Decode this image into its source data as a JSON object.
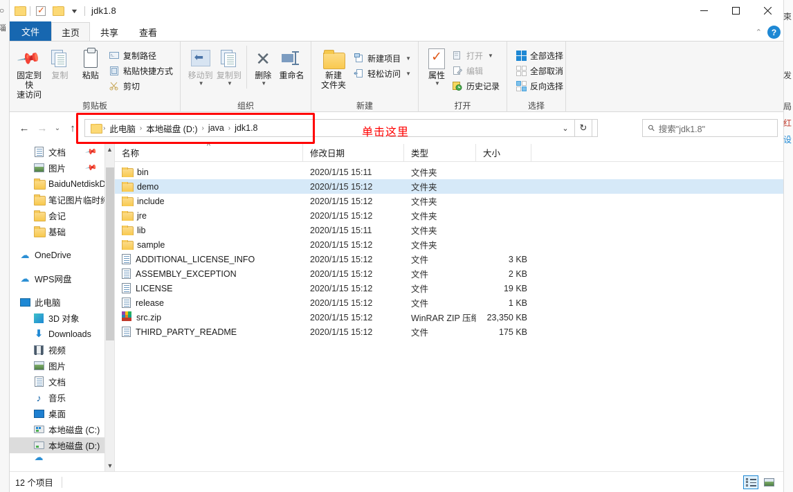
{
  "window": {
    "title": "jdk1.8",
    "quick_access": [
      "folder-icon",
      "properties-check-icon",
      "new-folder-icon",
      "customize-caret-icon"
    ],
    "controls": {
      "minimize": "—",
      "maximize": "❐",
      "close": "✕"
    }
  },
  "tabs": {
    "file": "文件",
    "items": [
      {
        "label": "主页",
        "active": true
      },
      {
        "label": "共享",
        "active": false
      },
      {
        "label": "查看",
        "active": false
      }
    ],
    "collapse_icon": "chevron-up-icon",
    "help_icon": "help-icon",
    "help_label": "?"
  },
  "ribbon": {
    "groups": [
      {
        "title": "剪贴板",
        "big": [
          {
            "label1": "固定到快",
            "label2": "速访问",
            "icon": "pin-icon",
            "dim": false
          },
          {
            "label1": "复制",
            "label2": "",
            "icon": "copy-icon",
            "dim": true
          },
          {
            "label1": "粘贴",
            "label2": "",
            "icon": "paste-icon",
            "dim": false
          }
        ],
        "small": [
          {
            "label": "复制路径",
            "icon": "copy-path-icon",
            "dim": false
          },
          {
            "label": "粘贴快捷方式",
            "icon": "paste-shortcut-icon",
            "dim": false
          },
          {
            "label": "剪切",
            "icon": "scissors-icon",
            "dim": false
          }
        ]
      },
      {
        "title": "组织",
        "big": [
          {
            "label1": "移动到",
            "label2": "",
            "icon": "move-to-icon",
            "dim": true
          },
          {
            "label1": "复制到",
            "label2": "",
            "icon": "copy-to-icon",
            "dim": true
          },
          {
            "label1": "删除",
            "label2": "",
            "icon": "delete-icon",
            "dim": false
          },
          {
            "label1": "重命名",
            "label2": "",
            "icon": "rename-icon",
            "dim": false
          }
        ]
      },
      {
        "title": "新建",
        "big": [
          {
            "label1": "新建",
            "label2": "文件夹",
            "icon": "new-folder-icon",
            "dim": false
          }
        ],
        "small": [
          {
            "label": "新建项目",
            "icon": "new-item-icon",
            "dim": false,
            "caret": true
          },
          {
            "label": "轻松访问",
            "icon": "easy-access-icon",
            "dim": false,
            "caret": true
          }
        ]
      },
      {
        "title": "打开",
        "big": [
          {
            "label1": "属性",
            "label2": "",
            "icon": "properties-icon",
            "dim": false
          }
        ],
        "small": [
          {
            "label": "打开",
            "icon": "open-icon",
            "dim": true,
            "caret": true
          },
          {
            "label": "编辑",
            "icon": "edit-icon",
            "dim": true
          },
          {
            "label": "历史记录",
            "icon": "history-icon",
            "dim": false
          }
        ]
      },
      {
        "title": "选择",
        "small": [
          {
            "label": "全部选择",
            "icon": "select-all-icon",
            "dim": false
          },
          {
            "label": "全部取消",
            "icon": "select-none-icon",
            "dim": false
          },
          {
            "label": "反向选择",
            "icon": "invert-selection-icon",
            "dim": false
          }
        ]
      }
    ]
  },
  "addressbar": {
    "back_icon": "arrow-left-icon",
    "forward_icon": "arrow-right-icon",
    "recent_icon": "chevron-down-icon",
    "up_icon": "arrow-up-icon",
    "folder_icon": "folder-icon",
    "breadcrumbs": [
      "此电脑",
      "本地磁盘 (D:)",
      "java",
      "jdk1.8"
    ],
    "separator": "›",
    "dropdown_icon": "chevron-down-icon",
    "refresh_icon": "refresh-icon",
    "refresh_glyph": "↻"
  },
  "search": {
    "icon": "search-icon",
    "placeholder": "搜索\"jdk1.8\"",
    "value": ""
  },
  "annotation": {
    "label": "单击这里",
    "color": "#ff0000"
  },
  "navpane": {
    "items": [
      {
        "label": "文档",
        "icon": "documents-icon",
        "indent": 2,
        "pinned": true,
        "selected": false
      },
      {
        "label": "图片",
        "icon": "pictures-icon",
        "indent": 2,
        "pinned": true,
        "selected": false
      },
      {
        "label": "BaiduNetdiskD",
        "icon": "folder-icon",
        "indent": 2,
        "pinned": false,
        "selected": false
      },
      {
        "label": "笔记图片临时纯",
        "icon": "folder-icon",
        "indent": 2,
        "pinned": false,
        "selected": false
      },
      {
        "label": "会记",
        "icon": "folder-icon",
        "indent": 2,
        "pinned": false,
        "selected": false
      },
      {
        "label": "基础",
        "icon": "folder-icon",
        "indent": 2,
        "pinned": false,
        "selected": false
      },
      {
        "spacer": true
      },
      {
        "label": "OneDrive",
        "icon": "onedrive-icon",
        "indent": 1,
        "pinned": false,
        "selected": false
      },
      {
        "spacer": true
      },
      {
        "label": "WPS网盘",
        "icon": "wps-cloud-icon",
        "indent": 1,
        "pinned": false,
        "selected": false
      },
      {
        "spacer": true
      },
      {
        "label": "此电脑",
        "icon": "this-pc-icon",
        "indent": 1,
        "pinned": false,
        "selected": false
      },
      {
        "label": "3D 对象",
        "icon": "3d-objects-icon",
        "indent": 2,
        "pinned": false,
        "selected": false
      },
      {
        "label": "Downloads",
        "icon": "downloads-icon",
        "indent": 2,
        "pinned": false,
        "selected": false
      },
      {
        "label": "视频",
        "icon": "videos-icon",
        "indent": 2,
        "pinned": false,
        "selected": false
      },
      {
        "label": "图片",
        "icon": "pictures-icon",
        "indent": 2,
        "pinned": false,
        "selected": false
      },
      {
        "label": "文档",
        "icon": "documents-icon",
        "indent": 2,
        "pinned": false,
        "selected": false
      },
      {
        "label": "音乐",
        "icon": "music-icon",
        "indent": 2,
        "pinned": false,
        "selected": false
      },
      {
        "label": "桌面",
        "icon": "desktop-icon",
        "indent": 2,
        "pinned": false,
        "selected": false
      },
      {
        "label": "本地磁盘 (C:)",
        "icon": "system-drive-icon",
        "indent": 2,
        "pinned": false,
        "selected": false
      },
      {
        "label": "本地磁盘 (D:)",
        "icon": "drive-icon",
        "indent": 2,
        "pinned": false,
        "selected": true
      }
    ],
    "scrollbar": {
      "up": "▲",
      "down": "▼"
    }
  },
  "filelist": {
    "columns": [
      {
        "label": "名称",
        "sorted": true
      },
      {
        "label": "修改日期",
        "sorted": false
      },
      {
        "label": "类型",
        "sorted": false
      },
      {
        "label": "大小",
        "sorted": false
      }
    ],
    "rows": [
      {
        "name": "bin",
        "date": "2020/1/15 15:11",
        "type": "文件夹",
        "size": "",
        "icon": "folder-icon",
        "selected": false
      },
      {
        "name": "demo",
        "date": "2020/1/15 15:12",
        "type": "文件夹",
        "size": "",
        "icon": "folder-icon",
        "selected": true
      },
      {
        "name": "include",
        "date": "2020/1/15 15:12",
        "type": "文件夹",
        "size": "",
        "icon": "folder-icon",
        "selected": false
      },
      {
        "name": "jre",
        "date": "2020/1/15 15:12",
        "type": "文件夹",
        "size": "",
        "icon": "folder-icon",
        "selected": false
      },
      {
        "name": "lib",
        "date": "2020/1/15 15:11",
        "type": "文件夹",
        "size": "",
        "icon": "folder-icon",
        "selected": false
      },
      {
        "name": "sample",
        "date": "2020/1/15 15:12",
        "type": "文件夹",
        "size": "",
        "icon": "folder-icon",
        "selected": false
      },
      {
        "name": "ADDITIONAL_LICENSE_INFO",
        "date": "2020/1/15 15:12",
        "type": "文件",
        "size": "3 KB",
        "icon": "file-icon",
        "selected": false
      },
      {
        "name": "ASSEMBLY_EXCEPTION",
        "date": "2020/1/15 15:12",
        "type": "文件",
        "size": "2 KB",
        "icon": "file-icon",
        "selected": false
      },
      {
        "name": "LICENSE",
        "date": "2020/1/15 15:12",
        "type": "文件",
        "size": "19 KB",
        "icon": "file-icon",
        "selected": false
      },
      {
        "name": "release",
        "date": "2020/1/15 15:12",
        "type": "文件",
        "size": "1 KB",
        "icon": "file-icon",
        "selected": false
      },
      {
        "name": "src.zip",
        "date": "2020/1/15 15:12",
        "type": "WinRAR ZIP 压缩...",
        "size": "23,350 KB",
        "icon": "winrar-zip-icon",
        "selected": false
      },
      {
        "name": "THIRD_PARTY_README",
        "date": "2020/1/15 15:12",
        "type": "文件",
        "size": "175 KB",
        "icon": "file-icon",
        "selected": false
      }
    ]
  },
  "statusbar": {
    "item_count": "12 个项目",
    "view_details_icon": "details-view-icon",
    "view_thumbnails_icon": "thumbnails-view-icon"
  },
  "background_window": {
    "left_glyphs": [
      "○",
      "淄"
    ],
    "right_glyphs": [
      "束",
      "发",
      "局",
      "红",
      "设"
    ]
  }
}
